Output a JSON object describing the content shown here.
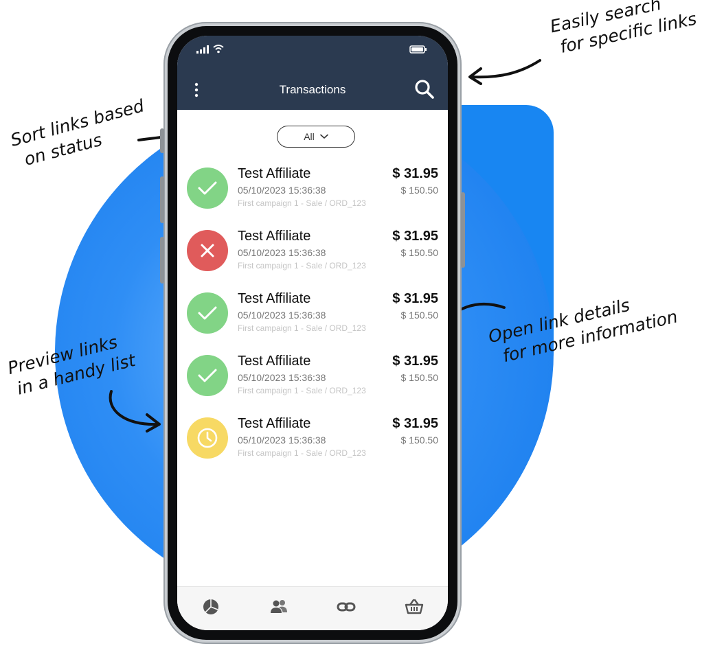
{
  "app": {
    "title": "Transactions"
  },
  "filter": {
    "label": "All"
  },
  "transactions": [
    {
      "status": "approved",
      "name": "Test Affiliate",
      "date": "05/10/2023 15:36:38",
      "campaign": "First campaign 1 - Sale / ORD_123",
      "commission": "$ 31.95",
      "total": "$ 150.50"
    },
    {
      "status": "declined",
      "name": "Test Affiliate",
      "date": "05/10/2023 15:36:38",
      "campaign": "First campaign 1 - Sale / ORD_123",
      "commission": "$ 31.95",
      "total": "$ 150.50"
    },
    {
      "status": "approved",
      "name": "Test Affiliate",
      "date": "05/10/2023 15:36:38",
      "campaign": "First campaign 1 - Sale / ORD_123",
      "commission": "$ 31.95",
      "total": "$ 150.50"
    },
    {
      "status": "approved",
      "name": "Test Affiliate",
      "date": "05/10/2023 15:36:38",
      "campaign": "First campaign 1 - Sale / ORD_123",
      "commission": "$ 31.95",
      "total": "$ 150.50"
    },
    {
      "status": "pending",
      "name": "Test Affiliate",
      "date": "05/10/2023 15:36:38",
      "campaign": "First campaign 1 - Sale / ORD_123",
      "commission": "$ 31.95",
      "total": "$ 150.50"
    }
  ],
  "annotations": {
    "search": [
      "Easily search",
      "for specific links"
    ],
    "sort": [
      "Sort links based",
      "on status"
    ],
    "details": [
      "Open link details",
      "for more information"
    ],
    "preview": [
      "Preview links",
      "in a handy list"
    ]
  },
  "icons": {
    "menu": "kebab-menu-icon",
    "search": "search-icon",
    "filter_caret": "chevron-down-icon",
    "approved": "check-icon",
    "declined": "x-icon",
    "pending": "clock-icon",
    "nav": [
      "pie-chart-icon",
      "users-icon",
      "link-icon",
      "basket-icon"
    ]
  },
  "colors": {
    "appbar": "#2b3a50",
    "approved": "#82d486",
    "declined": "#e05b5b",
    "pending": "#f7d964",
    "background_blue": "#1886f2"
  }
}
